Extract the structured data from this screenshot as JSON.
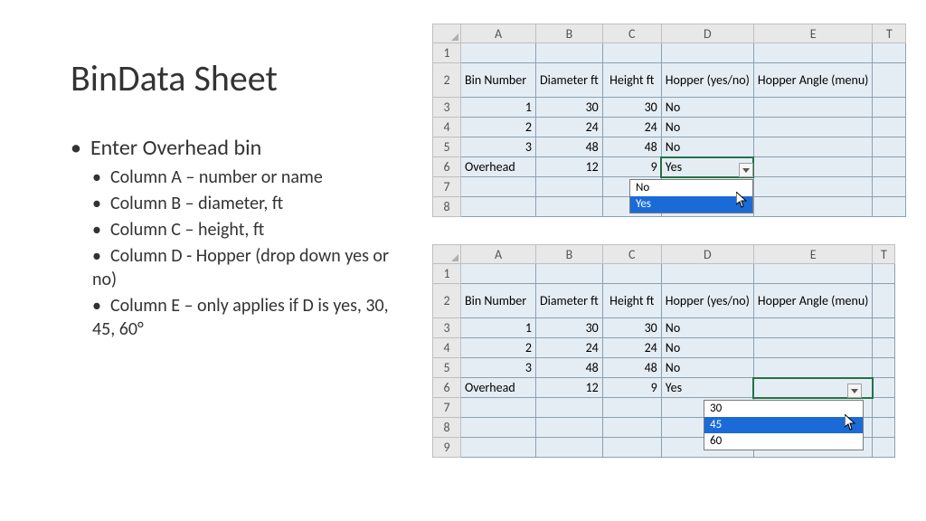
{
  "title": "BinData Sheet",
  "bullets": {
    "b1": "Enter Overhead bin",
    "b2a": "Column A – number or name",
    "b2b": "Column B – diameter, ft",
    "b2c": "Column C – height, ft",
    "b2d": "Column D - Hopper (drop down yes or no)",
    "b2e": "Column E – only applies if D is yes, 30, 45, 60°"
  },
  "cols": {
    "A": "A",
    "B": "B",
    "C": "C",
    "D": "D",
    "E": "E",
    "T": "T"
  },
  "headers": {
    "binNumber": "Bin Number",
    "diameter": "Diameter ft",
    "height": "Height ft",
    "hopper": "Hopper (yes/no)",
    "hopperAngle": "Hopper Angle (menu)"
  },
  "rows": [
    {
      "a": "1",
      "b": "30",
      "c": "30",
      "d": "No",
      "e": ""
    },
    {
      "a": "2",
      "b": "24",
      "c": "24",
      "d": "No",
      "e": ""
    },
    {
      "a": "3",
      "b": "48",
      "c": "48",
      "d": "No",
      "e": ""
    },
    {
      "a": "Overhead",
      "b": "12",
      "c": "9",
      "d": "Yes",
      "e": ""
    }
  ],
  "dropdownD": {
    "opt1": "No",
    "opt2": "Yes"
  },
  "dropdownE": {
    "opt1": "30",
    "opt2": "45",
    "opt3": "60"
  }
}
